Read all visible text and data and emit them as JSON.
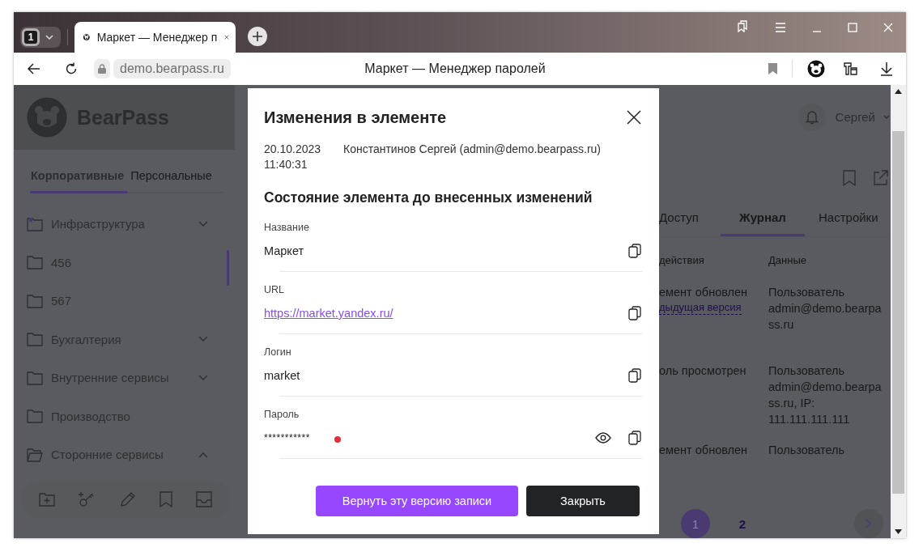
{
  "browser": {
    "tab_count": "1",
    "tabs": [
      {
        "title": "Маркет — Менеджер п",
        "selected": true
      }
    ],
    "address": "demo.bearpass.ru",
    "page_title": "Маркет — Менеджер паролей"
  },
  "app": {
    "logo": "BearPass",
    "sidebar": {
      "tabs": [
        {
          "label": "Корпоративные",
          "selected": true
        },
        {
          "label": "Персональные",
          "selected": false
        }
      ],
      "folders": [
        {
          "name": "Инфраструктура",
          "kind": "collapsed",
          "marked": true
        },
        {
          "name": "456",
          "kind": "leaf",
          "marked": false
        },
        {
          "name": "567",
          "kind": "leaf",
          "marked": false
        },
        {
          "name": "Бухгалтерия",
          "kind": "collapsed",
          "marked": false
        },
        {
          "name": "Внутренние сервисы",
          "kind": "collapsed",
          "marked": false
        },
        {
          "name": "Производство",
          "kind": "leaf",
          "marked": false
        },
        {
          "name": "Сторонние сервисы",
          "kind": "expanded",
          "marked": false
        }
      ]
    },
    "user": {
      "name": "Сергей"
    },
    "record": {
      "tabs": [
        {
          "label": "Доступ",
          "selected": false
        },
        {
          "label": "Журнал",
          "selected": true
        },
        {
          "label": "Настройки",
          "selected": false
        }
      ],
      "columns": [
        "действия",
        "Данные"
      ],
      "rows": [
        {
          "action": "емент обновлен",
          "link": "дыдущая версия",
          "data": "Пользователь admin@demo.bearpass.ru"
        },
        {
          "action": "оль просмотрен",
          "data": "Пользователь admin@demo.bearpass.ru, IP: 111.111.111.111"
        },
        {
          "action": "емент обновлен",
          "data": "Пользователь"
        }
      ],
      "pages": [
        {
          "label": "1",
          "selected": true
        },
        {
          "label": "2",
          "selected": false
        }
      ]
    }
  },
  "modal": {
    "title": "Изменения в элементе",
    "date": "20.10.2023",
    "time": "11:40:31",
    "author": "Константинов Сергей (admin@demo.bearpass.ru)",
    "section_title": "Состояние элемента до внесенных изменений",
    "fields": [
      {
        "label": "Название",
        "value": "Маркет",
        "kind": "text"
      },
      {
        "label": "URL",
        "value": "https://market.yandex.ru/",
        "kind": "link"
      },
      {
        "label": "Логин",
        "value": "market",
        "kind": "text"
      },
      {
        "label": "Пароль",
        "value": "***********",
        "kind": "secret"
      }
    ],
    "buttons": [
      {
        "label": "Вернуть эту версию записи",
        "kind": "primary"
      },
      {
        "label": "Закрыть",
        "kind": "secondary"
      }
    ]
  }
}
